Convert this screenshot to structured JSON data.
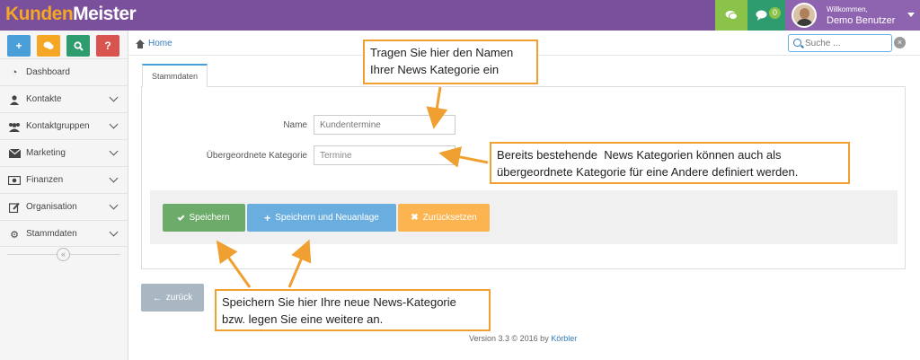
{
  "app": {
    "logo_part1": "Kunden",
    "logo_part2": "Meister"
  },
  "topbar": {
    "message_count": "0",
    "welcome": "Willkommen,",
    "username": "Demo Benutzer"
  },
  "quick_actions": [
    "+",
    "✚",
    "⌕",
    "?"
  ],
  "sidebar": {
    "items": [
      {
        "label": "Dashboard",
        "icon": "tachometer-icon",
        "glyph": "◔"
      },
      {
        "label": "Kontakte",
        "icon": "user-icon",
        "glyph": "👤"
      },
      {
        "label": "Kontaktgruppen",
        "icon": "users-icon",
        "glyph": "👥"
      },
      {
        "label": "Marketing",
        "icon": "envelope-icon",
        "glyph": "✉"
      },
      {
        "label": "Finanzen",
        "icon": "money-icon",
        "glyph": "▣"
      },
      {
        "label": "Organisation",
        "icon": "edit-icon",
        "glyph": "✎"
      },
      {
        "label": "Stammdaten",
        "icon": "cogs-icon",
        "glyph": "⚙"
      }
    ],
    "collapse_glyph": "«"
  },
  "breadcrumb": {
    "home": "Home"
  },
  "search": {
    "placeholder": "Suche ..."
  },
  "tabs": [
    {
      "label": "Stammdaten",
      "active": true
    }
  ],
  "form": {
    "name_label": "Name",
    "name_placeholder": "Kundentermine",
    "parent_label": "Übergeordnete Kategorie",
    "parent_value": "Termine",
    "save_label": "Speichern",
    "save_new_label": "Speichern und Neuanlage",
    "reset_label": "Zurücksetzen"
  },
  "back_label": "zurück",
  "footer": {
    "version": "Version 3.3 © 2016 by",
    "vendor": "Körbler"
  },
  "callouts": {
    "name_hint_line1": "Tragen Sie hier den Namen",
    "name_hint_line2": "Ihrer News Kategorie ein",
    "parent_hint_line1": "Bereits bestehende  News Kategorien können auch als",
    "parent_hint_line2": "übergeordnete Kategorie für eine Andere definiert werden.",
    "save_hint_line1": "Speichern Sie hier Ihre neue News-Kategorie",
    "save_hint_line2": "bzw. legen Sie eine weitere an."
  },
  "colors": {
    "topbar": "#7a4f9c",
    "accent_orange": "#f0a030",
    "save_green": "#6dab6a",
    "save_new_blue": "#6aaee0",
    "reset_orange": "#fbb450"
  }
}
